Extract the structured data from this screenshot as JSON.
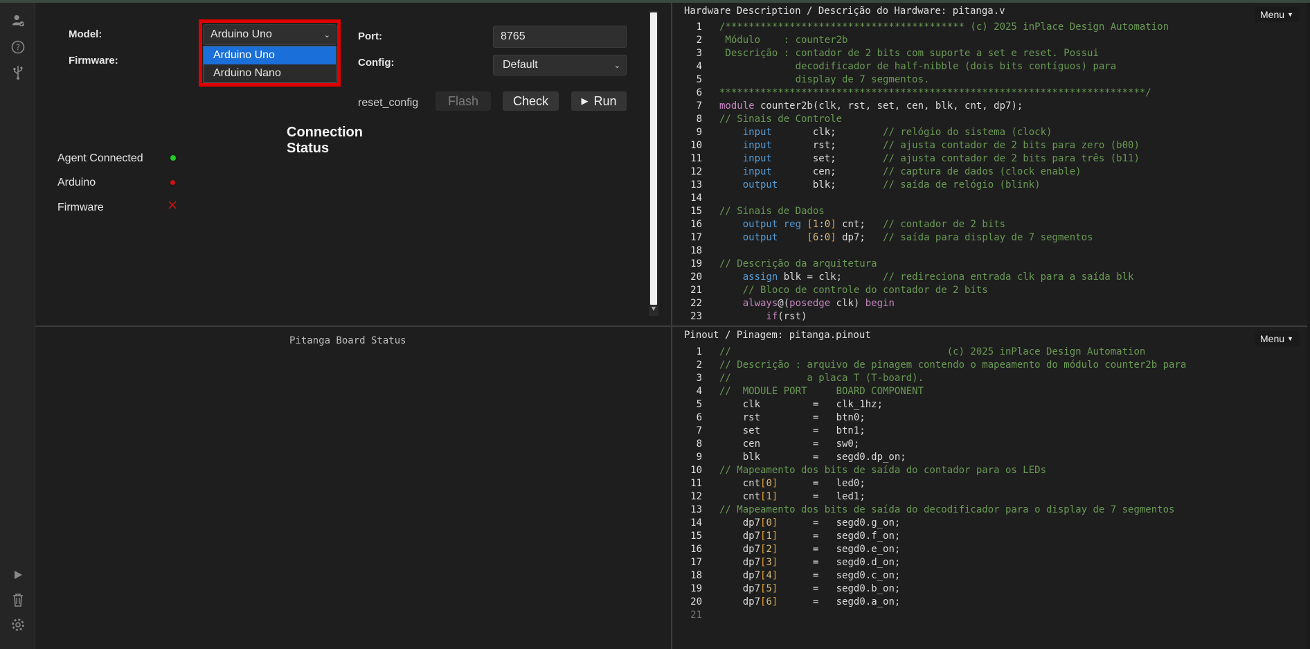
{
  "sidebar": {
    "icons": [
      "user-check-icon",
      "help-icon",
      "usb-icon",
      "play-icon",
      "trash-icon",
      "settings-icon"
    ]
  },
  "form": {
    "model_label": "Model:",
    "model_value": "Arduino Uno",
    "model_options": [
      "Arduino Uno",
      "Arduino Nano"
    ],
    "firmware_label": "Firmware:",
    "port_label": "Port:",
    "port_value": "8765",
    "config_label": "Config:",
    "config_value": "Default"
  },
  "actions": {
    "reset_config": "reset_config",
    "flash": "Flash",
    "check": "Check",
    "run": "Run"
  },
  "connection": {
    "title": "Connection Status",
    "items": [
      {
        "label": "Agent Connected",
        "state": "ok",
        "color": "#22cc22"
      },
      {
        "label": "Arduino",
        "state": "error",
        "color": "#cc1111"
      },
      {
        "label": "Firmware",
        "state": "missing",
        "color": "#cc1111"
      }
    ]
  },
  "board_status": {
    "title": "Pitanga Board Status"
  },
  "hw_editor": {
    "title": "Hardware Description / Descrição do Hardware: pitanga.v",
    "menu": "Menu",
    "lines": [
      [
        [
          "cm",
          "/***************************************** (c) 2025 inPlace Design Automation"
        ]
      ],
      [
        [
          "cm",
          " Módulo    : counter2b"
        ]
      ],
      [
        [
          "cm",
          " Descrição : contador de 2 bits com suporte a set e reset. Possui"
        ]
      ],
      [
        [
          "cm",
          "             decodificador de half-nibble (dois bits contíguos) para"
        ]
      ],
      [
        [
          "cm",
          "             display de 7 segmentos."
        ]
      ],
      [
        [
          "cm",
          "*************************************************************************/"
        ]
      ],
      [
        [
          "kw",
          "module"
        ],
        [
          "tx",
          " counter2b(clk, rst, set, cen, blk, cnt, dp7);"
        ]
      ],
      [
        [
          "cm",
          "// Sinais de Controle"
        ]
      ],
      [
        [
          "tx",
          "    "
        ],
        [
          "ty",
          "input"
        ],
        [
          "tx",
          "       clk;        "
        ],
        [
          "cm",
          "// relógio do sistema (clock)"
        ]
      ],
      [
        [
          "tx",
          "    "
        ],
        [
          "ty",
          "input"
        ],
        [
          "tx",
          "       rst;        "
        ],
        [
          "cm",
          "// ajusta contador de 2 bits para zero (b00)"
        ]
      ],
      [
        [
          "tx",
          "    "
        ],
        [
          "ty",
          "input"
        ],
        [
          "tx",
          "       set;        "
        ],
        [
          "cm",
          "// ajusta contador de 2 bits para três (b11)"
        ]
      ],
      [
        [
          "tx",
          "    "
        ],
        [
          "ty",
          "input"
        ],
        [
          "tx",
          "       cen;        "
        ],
        [
          "cm",
          "// captura de dados (clock enable)"
        ]
      ],
      [
        [
          "tx",
          "    "
        ],
        [
          "ty",
          "output"
        ],
        [
          "tx",
          "      blk;        "
        ],
        [
          "cm",
          "// saída de relógio (blink)"
        ]
      ],
      [
        [
          "tx",
          ""
        ]
      ],
      [
        [
          "cm",
          "// Sinais de Dados"
        ]
      ],
      [
        [
          "tx",
          "    "
        ],
        [
          "ty",
          "output reg"
        ],
        [
          "tx",
          " "
        ],
        [
          "br",
          "["
        ],
        [
          "num",
          "1"
        ],
        [
          "tx",
          ":"
        ],
        [
          "num",
          "0"
        ],
        [
          "br",
          "]"
        ],
        [
          "tx",
          " cnt;   "
        ],
        [
          "cm",
          "// contador de 2 bits"
        ]
      ],
      [
        [
          "tx",
          "    "
        ],
        [
          "ty",
          "output"
        ],
        [
          "tx",
          "     "
        ],
        [
          "br",
          "["
        ],
        [
          "num",
          "6"
        ],
        [
          "tx",
          ":"
        ],
        [
          "num",
          "0"
        ],
        [
          "br",
          "]"
        ],
        [
          "tx",
          " dp7;   "
        ],
        [
          "cm",
          "// saída para display de 7 segmentos"
        ]
      ],
      [
        [
          "tx",
          ""
        ]
      ],
      [
        [
          "cm",
          "// Descrição da arquitetura"
        ]
      ],
      [
        [
          "tx",
          "    "
        ],
        [
          "ty",
          "assign"
        ],
        [
          "tx",
          " blk = clk;       "
        ],
        [
          "cm",
          "// redireciona entrada clk para a saída blk"
        ]
      ],
      [
        [
          "tx",
          "    "
        ],
        [
          "cm",
          "// Bloco de controle do contador de 2 bits"
        ]
      ],
      [
        [
          "tx",
          "    "
        ],
        [
          "kw",
          "always"
        ],
        [
          "tx",
          "@("
        ],
        [
          "kw",
          "posedge"
        ],
        [
          "tx",
          " clk) "
        ],
        [
          "kw",
          "begin"
        ]
      ],
      [
        [
          "tx",
          "        "
        ],
        [
          "kw",
          "if"
        ],
        [
          "tx",
          "(rst)"
        ]
      ]
    ]
  },
  "pin_editor": {
    "title": "Pinout / Pinagem: pitanga.pinout",
    "menu": "Menu",
    "lines": [
      [
        [
          "cm",
          "//                                     (c) 2025 inPlace Design Automation"
        ]
      ],
      [
        [
          "cm",
          "// Descrição : arquivo de pinagem contendo o mapeamento do módulo counter2b para"
        ]
      ],
      [
        [
          "cm",
          "//             a placa T (T-board)."
        ]
      ],
      [
        [
          "cm",
          "//  MODULE PORT     BOARD COMPONENT"
        ]
      ],
      [
        [
          "tx",
          "    clk         =   clk_1hz;"
        ]
      ],
      [
        [
          "tx",
          "    rst         =   btn0;"
        ]
      ],
      [
        [
          "tx",
          "    set         =   btn1;"
        ]
      ],
      [
        [
          "tx",
          "    cen         =   sw0;"
        ]
      ],
      [
        [
          "tx",
          "    blk         =   segd0.dp_on;"
        ]
      ],
      [
        [
          "cm",
          "// Mapeamento dos bits de saída do contador para os LEDs"
        ]
      ],
      [
        [
          "tx",
          "    cnt"
        ],
        [
          "br",
          "["
        ],
        [
          "num",
          "0"
        ],
        [
          "br",
          "]"
        ],
        [
          "tx",
          "      =   led0;"
        ]
      ],
      [
        [
          "tx",
          "    cnt"
        ],
        [
          "br",
          "["
        ],
        [
          "num",
          "1"
        ],
        [
          "br",
          "]"
        ],
        [
          "tx",
          "      =   led1;"
        ]
      ],
      [
        [
          "cm",
          "// Mapeamento dos bits de saída do decodificador para o display de 7 segmentos"
        ]
      ],
      [
        [
          "tx",
          "    dp7"
        ],
        [
          "br",
          "["
        ],
        [
          "num",
          "0"
        ],
        [
          "br",
          "]"
        ],
        [
          "tx",
          "      =   segd0.g_on;"
        ]
      ],
      [
        [
          "tx",
          "    dp7"
        ],
        [
          "br",
          "["
        ],
        [
          "num",
          "1"
        ],
        [
          "br",
          "]"
        ],
        [
          "tx",
          "      =   segd0.f_on;"
        ]
      ],
      [
        [
          "tx",
          "    dp7"
        ],
        [
          "br",
          "["
        ],
        [
          "num",
          "2"
        ],
        [
          "br",
          "]"
        ],
        [
          "tx",
          "      =   segd0.e_on;"
        ]
      ],
      [
        [
          "tx",
          "    dp7"
        ],
        [
          "br",
          "["
        ],
        [
          "num",
          "3"
        ],
        [
          "br",
          "]"
        ],
        [
          "tx",
          "      =   segd0.d_on;"
        ]
      ],
      [
        [
          "tx",
          "    dp7"
        ],
        [
          "br",
          "["
        ],
        [
          "num",
          "4"
        ],
        [
          "br",
          "]"
        ],
        [
          "tx",
          "      =   segd0.c_on;"
        ]
      ],
      [
        [
          "tx",
          "    dp7"
        ],
        [
          "br",
          "["
        ],
        [
          "num",
          "5"
        ],
        [
          "br",
          "]"
        ],
        [
          "tx",
          "      =   segd0.b_on;"
        ]
      ],
      [
        [
          "tx",
          "    dp7"
        ],
        [
          "br",
          "["
        ],
        [
          "num",
          "6"
        ],
        [
          "br",
          "]"
        ],
        [
          "tx",
          "      =   segd0.a_on;"
        ]
      ],
      [
        [
          "tx",
          ""
        ]
      ]
    ]
  }
}
